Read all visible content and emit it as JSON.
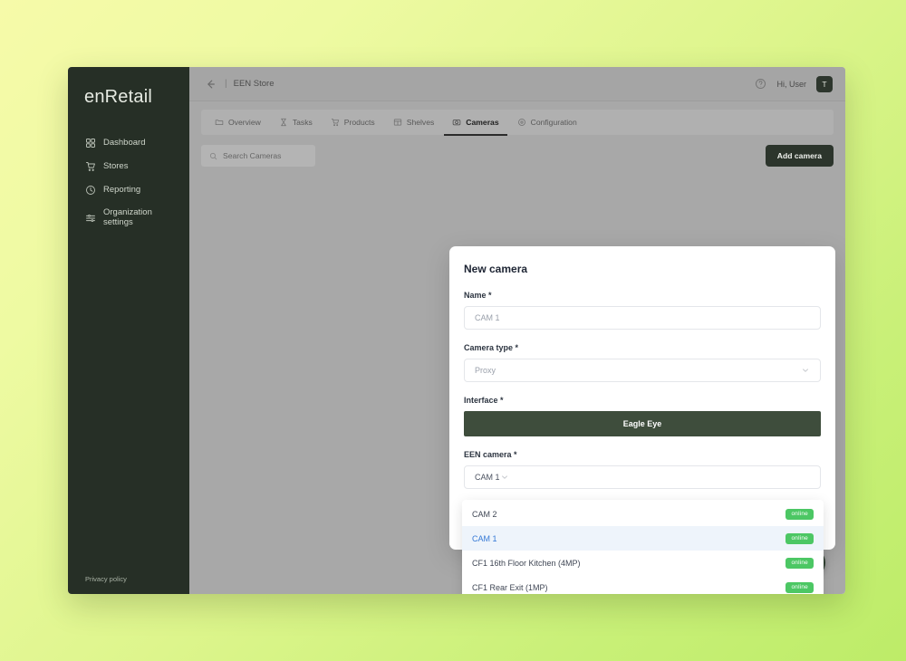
{
  "background": {
    "gradient_from": "#f6faa9",
    "gradient_to": "#bdec68"
  },
  "sidebar": {
    "brand": "enRetail",
    "items": [
      {
        "label": "Dashboard",
        "icon": "grid-icon"
      },
      {
        "label": "Stores",
        "icon": "cart-icon"
      },
      {
        "label": "Reporting",
        "icon": "clock-icon"
      },
      {
        "label": "Organization\nsettings",
        "icon": "sliders-icon"
      }
    ],
    "privacy_policy": "Privacy policy"
  },
  "header": {
    "back_icon": "arrow-left-icon",
    "separator": "|",
    "breadcrumb": "EEN Store",
    "help_icon": "help-circle-icon",
    "greeting": "Hi, User",
    "avatar_initial": "T"
  },
  "tabs": [
    {
      "label": "Overview",
      "icon": "folder-icon",
      "active": false
    },
    {
      "label": "Tasks",
      "icon": "hourglass-icon",
      "active": false
    },
    {
      "label": "Products",
      "icon": "cart-icon",
      "active": false
    },
    {
      "label": "Shelves",
      "icon": "table-icon",
      "active": false
    },
    {
      "label": "Cameras",
      "icon": "camera-icon",
      "active": true
    },
    {
      "label": "Configuration",
      "icon": "gear-icon",
      "active": false
    }
  ],
  "toolbar": {
    "search_placeholder": "Search Cameras",
    "search_value": "",
    "search_icon": "search-icon",
    "add_camera_label": "Add camera"
  },
  "modal": {
    "title": "New camera",
    "fields": {
      "name": {
        "label": "Name *",
        "placeholder": "CAM 1",
        "value": ""
      },
      "camera_type": {
        "label": "Camera type *",
        "value": "Proxy",
        "chevron": "chevron-down-icon"
      },
      "interface": {
        "label": "Interface *",
        "selected_option": "Eagle Eye"
      },
      "een_camera": {
        "label": "EEN camera *",
        "value": "CAM 1",
        "chevron": "chevron-down-icon"
      }
    },
    "dropdown": {
      "options": [
        {
          "label": "CAM 2",
          "status": "online",
          "selected": false
        },
        {
          "label": "CAM 1",
          "status": "online",
          "selected": true
        },
        {
          "label": "CF1 16th Floor Kitchen (4MP)",
          "status": "online",
          "selected": false
        },
        {
          "label": "CF1 Rear Exit (1MP)",
          "status": "online",
          "selected": false
        }
      ],
      "status_color": "#4cc764"
    }
  },
  "chat": {
    "icon": "chat-bubble-icon"
  },
  "colors": {
    "sidebar_bg": "#262f26",
    "accent_dark_green": "#2c352c",
    "interface_button": "#3e4d3c",
    "selected_blue": "#3579d6"
  }
}
